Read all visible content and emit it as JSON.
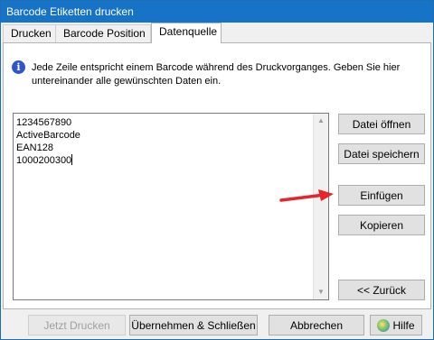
{
  "window": {
    "title": "Barcode Etiketten drucken"
  },
  "tabs": [
    {
      "label": "Drucken"
    },
    {
      "label": "Barcode Position"
    },
    {
      "label": "Datenquelle",
      "active": true
    }
  ],
  "info": {
    "icon": "info-icon",
    "text": "Jede Zeile entspricht einem Barcode während des Druckvorganges. Geben Sie hier untereinander alle gewünschten Daten ein."
  },
  "data_lines": [
    "1234567890",
    "ActiveBarcode",
    "EAN128",
    "1000200300"
  ],
  "side_buttons": {
    "open_file": "Datei öffnen",
    "save_file": "Datei speichern",
    "insert": "Einfügen",
    "copy": "Kopieren",
    "back": "<< Zurück"
  },
  "footer_buttons": {
    "print_now": "Jetzt Drucken",
    "apply_close": "Übernehmen & Schließen",
    "cancel": "Abbrechen",
    "help": "Hilfe"
  },
  "colors": {
    "titlebar": "#1773c7",
    "arrow": "#e8232a"
  }
}
